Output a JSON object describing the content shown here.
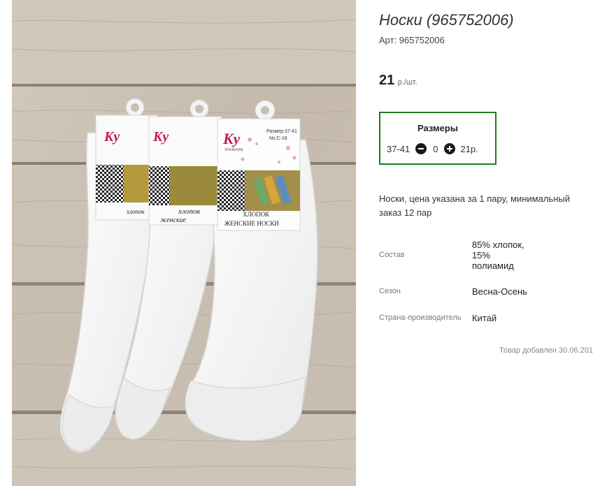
{
  "product": {
    "title": "Носки (965752006)",
    "article": "Арт: 965752006",
    "price_value": "21",
    "price_unit": "р./шт."
  },
  "sizes": {
    "title": "Размеры",
    "rows": [
      {
        "label": "37-41",
        "quantity": "0",
        "price": "21р."
      }
    ]
  },
  "description": "Носки, цена указана за 1 пару, минимальный заказ 12 пар",
  "properties": [
    {
      "key": "Состав",
      "value": "85% хлопок, 15% полиамид"
    },
    {
      "key": "Сезон",
      "value": "Весна-Осень"
    },
    {
      "key": "Страна-производитель",
      "value": "Китай"
    }
  ],
  "added_text": "Товар добавлен 30.06.201",
  "photo": {
    "brand": "Ky",
    "subbrand": "SPKAEHAE",
    "size_text": "Размер:37-41",
    "model_text": "Ns:C-18",
    "label_line1": "ХЛОПОК",
    "label_line2": "ЖЕНСКИЕ НОСКИ",
    "label_left_line1": "хлопок",
    "label_left_line2": "женские"
  },
  "colors": {
    "sizes_border": "#1f7a1f",
    "stepper_button": "#1a1a1a",
    "wood": "#c9bfb2"
  }
}
